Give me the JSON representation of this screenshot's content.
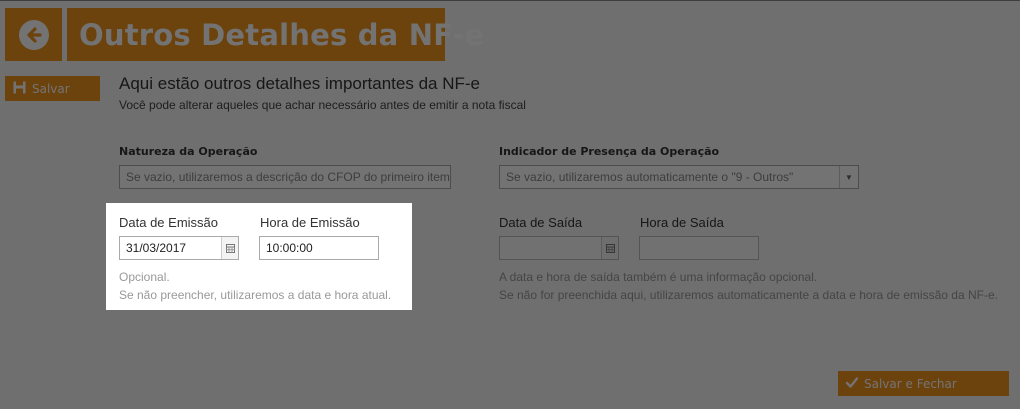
{
  "header": {
    "back_icon": "arrow-left-circle-icon",
    "title": "Outros Detalhes da NF-e"
  },
  "sidebar": {
    "save_label": "Salvar",
    "save_icon": "floppy-disk-icon"
  },
  "intro": {
    "heading": "Aqui estão outros detalhes importantes da NF-e",
    "subheading": "Você pode alterar aqueles que achar necessário antes de emitir a nota fiscal"
  },
  "natureza": {
    "label": "Natureza da Operação",
    "placeholder": "Se vazio, utilizaremos a descrição do CFOP do primeiro item"
  },
  "presenca": {
    "label": "Indicador de Presença da Operação",
    "placeholder": "Se vazio, utilizaremos automaticamente o \"9 - Outros\""
  },
  "emissao": {
    "date_label": "Data de Emissão",
    "date_value": "31/03/2017",
    "time_label": "Hora de Emissão",
    "time_value": "10:00:00",
    "help_line1": "Opcional.",
    "help_line2": "Se não preencher, utilizaremos a data e hora atual."
  },
  "saida": {
    "date_label": "Data de Saída",
    "date_value": "",
    "time_label": "Hora de Saída",
    "time_value": "",
    "help_line1": "A data e hora de saída também é uma informação opcional.",
    "help_line2": "Se não for preenchida aqui, utilizaremos automaticamente a data e hora de emissão da NF-e."
  },
  "footer": {
    "save_close_label": "Salvar e Fechar",
    "save_close_icon": "checkmark-icon"
  },
  "colors": {
    "accent": "#f0921e",
    "background": "#f5f5f5",
    "overlay": "rgba(0,0,0,0.55)"
  }
}
